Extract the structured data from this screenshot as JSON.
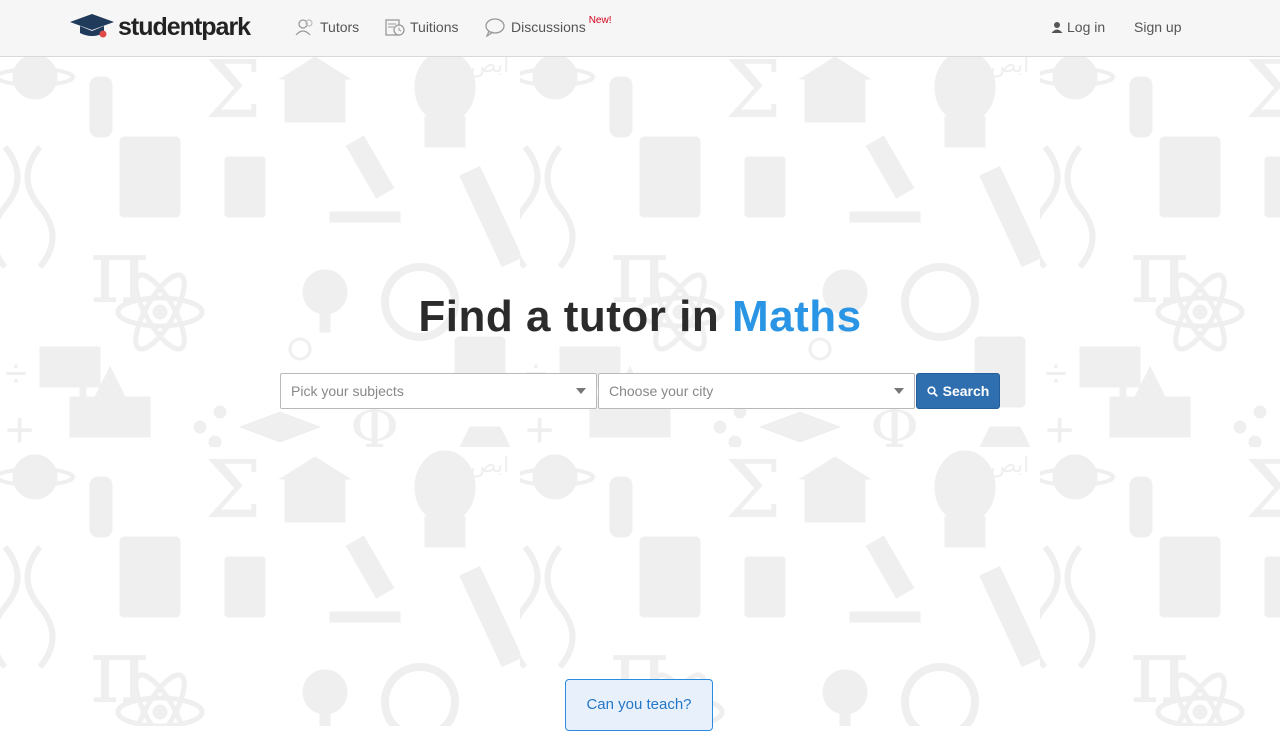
{
  "brand": {
    "name": "studentpark",
    "logo_icon": "graduation-cap-icon"
  },
  "nav": {
    "items": [
      {
        "label": "Tutors",
        "icon": "tutors-icon"
      },
      {
        "label": "Tuitions",
        "icon": "tuitions-icon"
      },
      {
        "label": "Discussions",
        "icon": "discussions-icon",
        "badge": "New!"
      }
    ],
    "login_label": "Log in",
    "login_icon": "user-icon",
    "signup_label": "Sign up"
  },
  "hero": {
    "title_prefix": "Find a tutor in",
    "title_accent": "Maths"
  },
  "search": {
    "subjects_placeholder": "Pick your subjects",
    "city_placeholder": "Choose your city",
    "button_label": "Search",
    "button_icon": "search-icon"
  },
  "cta": {
    "teach_label": "Can you teach?"
  },
  "colors": {
    "accent": "#2a95e4",
    "button": "#2f6fb0",
    "badge": "#d0021b",
    "header_bg": "#f6f6f6"
  }
}
